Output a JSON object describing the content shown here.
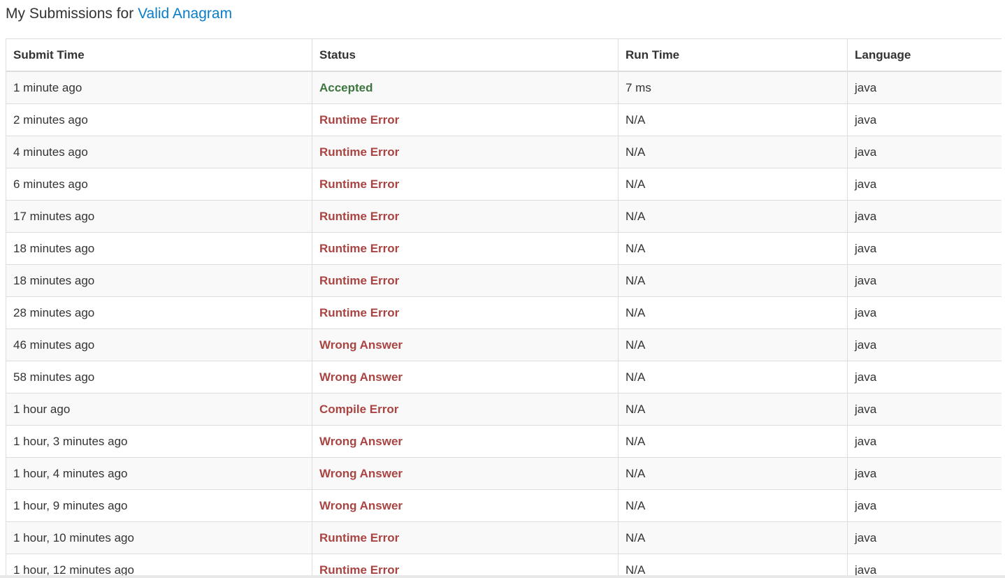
{
  "header": {
    "prefix": "My Submissions for ",
    "problem": "Valid Anagram"
  },
  "table": {
    "columns": [
      "Submit Time",
      "Status",
      "Run Time",
      "Language"
    ],
    "rows": [
      {
        "time": "1 minute ago",
        "status": "Accepted",
        "accepted": true,
        "runtime": "7 ms",
        "language": "java"
      },
      {
        "time": "2 minutes ago",
        "status": "Runtime Error",
        "accepted": false,
        "runtime": "N/A",
        "language": "java"
      },
      {
        "time": "4 minutes ago",
        "status": "Runtime Error",
        "accepted": false,
        "runtime": "N/A",
        "language": "java"
      },
      {
        "time": "6 minutes ago",
        "status": "Runtime Error",
        "accepted": false,
        "runtime": "N/A",
        "language": "java"
      },
      {
        "time": "17 minutes ago",
        "status": "Runtime Error",
        "accepted": false,
        "runtime": "N/A",
        "language": "java"
      },
      {
        "time": "18 minutes ago",
        "status": "Runtime Error",
        "accepted": false,
        "runtime": "N/A",
        "language": "java"
      },
      {
        "time": "18 minutes ago",
        "status": "Runtime Error",
        "accepted": false,
        "runtime": "N/A",
        "language": "java"
      },
      {
        "time": "28 minutes ago",
        "status": "Runtime Error",
        "accepted": false,
        "runtime": "N/A",
        "language": "java"
      },
      {
        "time": "46 minutes ago",
        "status": "Wrong Answer",
        "accepted": false,
        "runtime": "N/A",
        "language": "java"
      },
      {
        "time": "58 minutes ago",
        "status": "Wrong Answer",
        "accepted": false,
        "runtime": "N/A",
        "language": "java"
      },
      {
        "time": "1 hour ago",
        "status": "Compile Error",
        "accepted": false,
        "runtime": "N/A",
        "language": "java"
      },
      {
        "time": "1 hour, 3 minutes ago",
        "status": "Wrong Answer",
        "accepted": false,
        "runtime": "N/A",
        "language": "java"
      },
      {
        "time": "1 hour, 4 minutes ago",
        "status": "Wrong Answer",
        "accepted": false,
        "runtime": "N/A",
        "language": "java"
      },
      {
        "time": "1 hour, 9 minutes ago",
        "status": "Wrong Answer",
        "accepted": false,
        "runtime": "N/A",
        "language": "java"
      },
      {
        "time": "1 hour, 10 minutes ago",
        "status": "Runtime Error",
        "accepted": false,
        "runtime": "N/A",
        "language": "java"
      },
      {
        "time": "1 hour, 12 minutes ago",
        "status": "Runtime Error",
        "accepted": false,
        "runtime": "N/A",
        "language": "java"
      }
    ]
  },
  "colors": {
    "accepted": "#3c763d",
    "error": "#a94442",
    "link": "#0a7dc9"
  }
}
